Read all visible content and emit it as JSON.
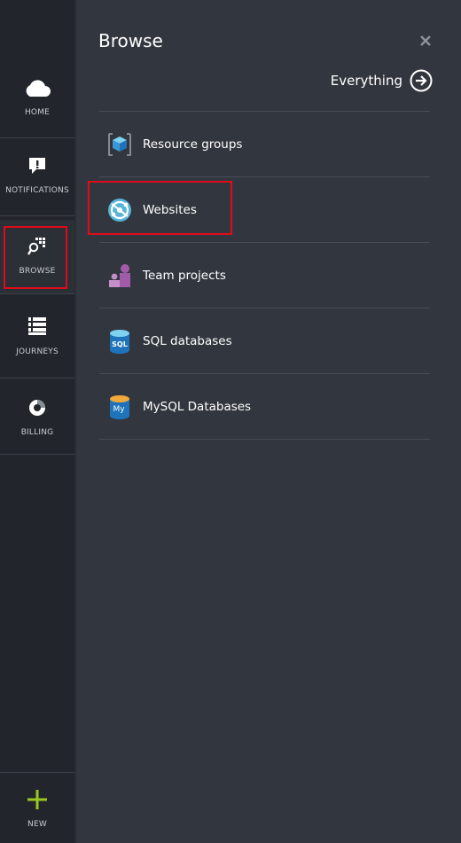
{
  "nav": {
    "items": [
      {
        "label": "HOME",
        "icon": "cloud-icon"
      },
      {
        "label": "NOTIFICATIONS",
        "icon": "notification-icon"
      },
      {
        "label": "BROWSE",
        "icon": "browse-icon"
      },
      {
        "label": "JOURNEYS",
        "icon": "journeys-icon"
      },
      {
        "label": "BILLING",
        "icon": "billing-icon"
      }
    ],
    "new_label": "NEW"
  },
  "panel": {
    "title": "Browse",
    "everything_label": "Everything",
    "items": [
      {
        "label": "Resource groups",
        "icon": "resource-groups-icon"
      },
      {
        "label": "Websites",
        "icon": "websites-icon"
      },
      {
        "label": "Team projects",
        "icon": "team-projects-icon"
      },
      {
        "label": "SQL databases",
        "icon": "sql-database-icon",
        "badge": "SQL"
      },
      {
        "label": "MySQL Databases",
        "icon": "mysql-database-icon",
        "badge": "My"
      }
    ]
  },
  "colors": {
    "rail_bg": "#22262c",
    "panel_bg": "#32373f",
    "highlight": "#e00b1a",
    "new_plus": "#9ac81f"
  }
}
